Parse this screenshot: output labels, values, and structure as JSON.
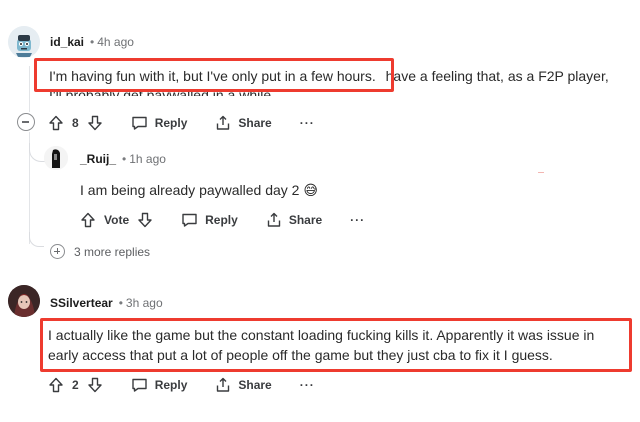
{
  "comments": [
    {
      "username": "id_kai",
      "time": "4h ago",
      "text_line1_highlighted": "I'm having fun with it, but I've only put in a few hours.",
      "text_line1_rest": "have a feeling that, as a F2P player,",
      "text_line2": "I'll probably get paywalled in a while",
      "votes": "8",
      "reply_label": "Reply",
      "share_label": "Share",
      "more_label": "···"
    },
    {
      "username": "_Ruij_",
      "time": "1h ago",
      "text": "I am being already paywalled day 2 😅",
      "vote_label": "Vote",
      "reply_label": "Reply",
      "share_label": "Share",
      "more_label": "···"
    },
    {
      "username": "SSilvertear",
      "time": "3h ago",
      "text_line1": "I actually like the game but the constant loading fucking kills it. Apparently it was issue in",
      "text_line2": "early access that put a lot of people off the game but they just cba to fix it I guess.",
      "votes": "2",
      "reply_label": "Reply",
      "share_label": "Share",
      "more_label": "···"
    }
  ],
  "more_replies": "3 more replies",
  "colors": {
    "highlight": "#ee3b2f",
    "text": "#1c1c1c",
    "muted": "#6f7174"
  }
}
